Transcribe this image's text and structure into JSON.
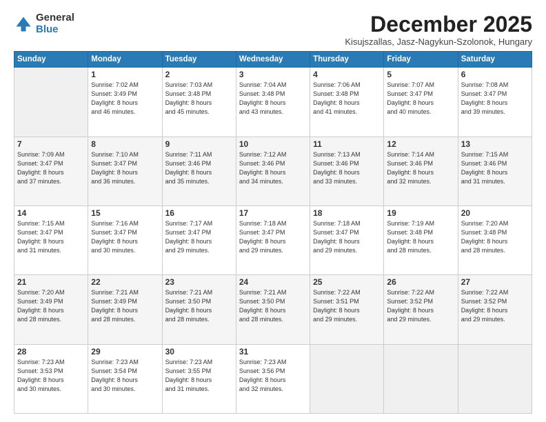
{
  "logo": {
    "general": "General",
    "blue": "Blue"
  },
  "title": "December 2025",
  "subtitle": "Kisujszallas, Jasz-Nagykun-Szolonok, Hungary",
  "days_header": [
    "Sunday",
    "Monday",
    "Tuesday",
    "Wednesday",
    "Thursday",
    "Friday",
    "Saturday"
  ],
  "weeks": [
    [
      {
        "day": "",
        "info": ""
      },
      {
        "day": "1",
        "info": "Sunrise: 7:02 AM\nSunset: 3:49 PM\nDaylight: 8 hours\nand 46 minutes."
      },
      {
        "day": "2",
        "info": "Sunrise: 7:03 AM\nSunset: 3:48 PM\nDaylight: 8 hours\nand 45 minutes."
      },
      {
        "day": "3",
        "info": "Sunrise: 7:04 AM\nSunset: 3:48 PM\nDaylight: 8 hours\nand 43 minutes."
      },
      {
        "day": "4",
        "info": "Sunrise: 7:06 AM\nSunset: 3:48 PM\nDaylight: 8 hours\nand 41 minutes."
      },
      {
        "day": "5",
        "info": "Sunrise: 7:07 AM\nSunset: 3:47 PM\nDaylight: 8 hours\nand 40 minutes."
      },
      {
        "day": "6",
        "info": "Sunrise: 7:08 AM\nSunset: 3:47 PM\nDaylight: 8 hours\nand 39 minutes."
      }
    ],
    [
      {
        "day": "7",
        "info": "Sunrise: 7:09 AM\nSunset: 3:47 PM\nDaylight: 8 hours\nand 37 minutes."
      },
      {
        "day": "8",
        "info": "Sunrise: 7:10 AM\nSunset: 3:47 PM\nDaylight: 8 hours\nand 36 minutes."
      },
      {
        "day": "9",
        "info": "Sunrise: 7:11 AM\nSunset: 3:46 PM\nDaylight: 8 hours\nand 35 minutes."
      },
      {
        "day": "10",
        "info": "Sunrise: 7:12 AM\nSunset: 3:46 PM\nDaylight: 8 hours\nand 34 minutes."
      },
      {
        "day": "11",
        "info": "Sunrise: 7:13 AM\nSunset: 3:46 PM\nDaylight: 8 hours\nand 33 minutes."
      },
      {
        "day": "12",
        "info": "Sunrise: 7:14 AM\nSunset: 3:46 PM\nDaylight: 8 hours\nand 32 minutes."
      },
      {
        "day": "13",
        "info": "Sunrise: 7:15 AM\nSunset: 3:46 PM\nDaylight: 8 hours\nand 31 minutes."
      }
    ],
    [
      {
        "day": "14",
        "info": "Sunrise: 7:15 AM\nSunset: 3:47 PM\nDaylight: 8 hours\nand 31 minutes."
      },
      {
        "day": "15",
        "info": "Sunrise: 7:16 AM\nSunset: 3:47 PM\nDaylight: 8 hours\nand 30 minutes."
      },
      {
        "day": "16",
        "info": "Sunrise: 7:17 AM\nSunset: 3:47 PM\nDaylight: 8 hours\nand 29 minutes."
      },
      {
        "day": "17",
        "info": "Sunrise: 7:18 AM\nSunset: 3:47 PM\nDaylight: 8 hours\nand 29 minutes."
      },
      {
        "day": "18",
        "info": "Sunrise: 7:18 AM\nSunset: 3:47 PM\nDaylight: 8 hours\nand 29 minutes."
      },
      {
        "day": "19",
        "info": "Sunrise: 7:19 AM\nSunset: 3:48 PM\nDaylight: 8 hours\nand 28 minutes."
      },
      {
        "day": "20",
        "info": "Sunrise: 7:20 AM\nSunset: 3:48 PM\nDaylight: 8 hours\nand 28 minutes."
      }
    ],
    [
      {
        "day": "21",
        "info": "Sunrise: 7:20 AM\nSunset: 3:49 PM\nDaylight: 8 hours\nand 28 minutes."
      },
      {
        "day": "22",
        "info": "Sunrise: 7:21 AM\nSunset: 3:49 PM\nDaylight: 8 hours\nand 28 minutes."
      },
      {
        "day": "23",
        "info": "Sunrise: 7:21 AM\nSunset: 3:50 PM\nDaylight: 8 hours\nand 28 minutes."
      },
      {
        "day": "24",
        "info": "Sunrise: 7:21 AM\nSunset: 3:50 PM\nDaylight: 8 hours\nand 28 minutes."
      },
      {
        "day": "25",
        "info": "Sunrise: 7:22 AM\nSunset: 3:51 PM\nDaylight: 8 hours\nand 29 minutes."
      },
      {
        "day": "26",
        "info": "Sunrise: 7:22 AM\nSunset: 3:52 PM\nDaylight: 8 hours\nand 29 minutes."
      },
      {
        "day": "27",
        "info": "Sunrise: 7:22 AM\nSunset: 3:52 PM\nDaylight: 8 hours\nand 29 minutes."
      }
    ],
    [
      {
        "day": "28",
        "info": "Sunrise: 7:23 AM\nSunset: 3:53 PM\nDaylight: 8 hours\nand 30 minutes."
      },
      {
        "day": "29",
        "info": "Sunrise: 7:23 AM\nSunset: 3:54 PM\nDaylight: 8 hours\nand 30 minutes."
      },
      {
        "day": "30",
        "info": "Sunrise: 7:23 AM\nSunset: 3:55 PM\nDaylight: 8 hours\nand 31 minutes."
      },
      {
        "day": "31",
        "info": "Sunrise: 7:23 AM\nSunset: 3:56 PM\nDaylight: 8 hours\nand 32 minutes."
      },
      {
        "day": "",
        "info": ""
      },
      {
        "day": "",
        "info": ""
      },
      {
        "day": "",
        "info": ""
      }
    ]
  ]
}
